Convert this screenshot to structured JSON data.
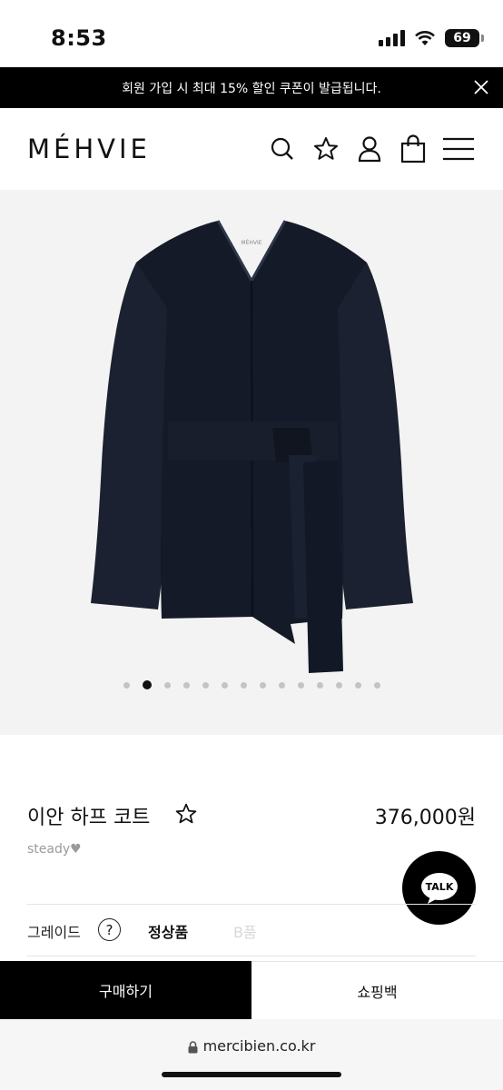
{
  "status": {
    "time": "8:53",
    "battery": "69"
  },
  "promo": {
    "text": "회원 가입 시 최대 15% 할인 쿠폰이 발급됩니다."
  },
  "brand": {
    "logo": "MÉHVIE"
  },
  "header_icons": [
    "search-icon",
    "star-icon",
    "user-icon",
    "shopping-bag-icon",
    "menu-icon"
  ],
  "gallery": {
    "total_slides": 14,
    "current_slide": 2,
    "label_on_garment": "MÉHVIE"
  },
  "product": {
    "name": "이안 하프 코트",
    "price": "376,000원",
    "seller": "steady♥"
  },
  "talk": {
    "label": "TALK"
  },
  "grade": {
    "label": "그레이드",
    "help": "?",
    "options": [
      "정상품",
      "B품"
    ],
    "selected": "정상품"
  },
  "actions": {
    "buy_label": "구매하기",
    "bag_label": "쇼핑백"
  },
  "browser": {
    "url": "mercibien.co.kr"
  },
  "colors": {
    "accent": "#000000",
    "coat": "#1a2030",
    "disabled": "#d8d8d8"
  }
}
